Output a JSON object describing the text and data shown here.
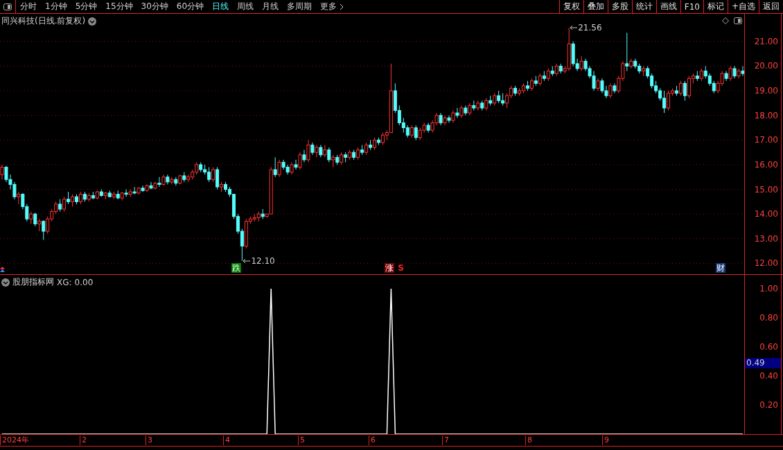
{
  "toolbar": {
    "period_tabs": [
      {
        "label": "分时",
        "selected": false
      },
      {
        "label": "1分钟",
        "selected": false
      },
      {
        "label": "5分钟",
        "selected": false
      },
      {
        "label": "15分钟",
        "selected": false
      },
      {
        "label": "30分钟",
        "selected": false
      },
      {
        "label": "60分钟",
        "selected": false
      },
      {
        "label": "日线",
        "selected": true
      },
      {
        "label": "周线",
        "selected": false
      },
      {
        "label": "月线",
        "selected": false
      },
      {
        "label": "多周期",
        "selected": false
      }
    ],
    "more": "更多",
    "buttons": [
      "复权",
      "叠加",
      "多股",
      "统计",
      "画线",
      "F10",
      "标记",
      "+自选",
      "返回"
    ]
  },
  "price_pane": {
    "title": "同兴科技(日线.前复权)",
    "events": [
      {
        "kind": "fall",
        "label": "跌"
      },
      {
        "kind": "rise",
        "label": "涨"
      },
      {
        "kind": "signal",
        "label": "S"
      },
      {
        "kind": "finance",
        "label": "财"
      }
    ],
    "chart_data": {
      "type": "candlestick",
      "grid": true,
      "ylim": [
        11.56,
        22.12
      ],
      "yticks": [
        {
          "value": 21,
          "label": "21.00"
        },
        {
          "value": 20,
          "label": "20.00"
        },
        {
          "value": 19,
          "label": "19.00"
        },
        {
          "value": 18,
          "label": "18.00"
        },
        {
          "value": 17,
          "label": "17.00"
        },
        {
          "value": 16,
          "label": "16.00"
        },
        {
          "value": 15,
          "label": "15.00"
        },
        {
          "value": 14,
          "label": "14.00"
        },
        {
          "value": 13,
          "label": "13.00"
        },
        {
          "value": 12,
          "label": "12.00"
        }
      ],
      "annotations": [
        "21.56",
        "12.10"
      ],
      "ohlc": [
        [
          15.6,
          16.0,
          15.4,
          15.9
        ],
        [
          15.9,
          15.95,
          15.3,
          15.4
        ],
        [
          15.4,
          15.6,
          15.0,
          15.2
        ],
        [
          15.2,
          15.3,
          14.6,
          14.7
        ],
        [
          14.7,
          14.9,
          14.4,
          14.8
        ],
        [
          14.8,
          14.85,
          14.2,
          14.3
        ],
        [
          14.3,
          14.4,
          13.7,
          13.8
        ],
        [
          13.8,
          14.1,
          13.6,
          14.0
        ],
        [
          14.0,
          14.05,
          13.5,
          13.6
        ],
        [
          13.6,
          13.8,
          13.3,
          13.7
        ],
        [
          13.7,
          13.75,
          12.95,
          13.3
        ],
        [
          13.3,
          13.9,
          13.2,
          13.8
        ],
        [
          13.8,
          14.2,
          13.7,
          14.1
        ],
        [
          14.1,
          14.5,
          14.0,
          14.4
        ],
        [
          14.4,
          14.6,
          14.1,
          14.2
        ],
        [
          14.2,
          14.7,
          14.1,
          14.6
        ],
        [
          14.6,
          14.9,
          14.4,
          14.5
        ],
        [
          14.5,
          14.8,
          14.3,
          14.7
        ],
        [
          14.7,
          14.8,
          14.4,
          14.5
        ],
        [
          14.5,
          14.9,
          14.4,
          14.8
        ],
        [
          14.8,
          14.9,
          14.5,
          14.6
        ],
        [
          14.6,
          14.85,
          14.5,
          14.75
        ],
        [
          14.75,
          14.9,
          14.6,
          14.65
        ],
        [
          14.65,
          14.95,
          14.6,
          14.9
        ],
        [
          14.9,
          15.0,
          14.7,
          14.75
        ],
        [
          14.75,
          14.9,
          14.6,
          14.85
        ],
        [
          14.85,
          14.95,
          14.7,
          14.7
        ],
        [
          14.7,
          14.9,
          14.6,
          14.8
        ],
        [
          14.8,
          14.95,
          14.6,
          14.65
        ],
        [
          14.65,
          14.9,
          14.55,
          14.85
        ],
        [
          14.85,
          15.0,
          14.7,
          14.8
        ],
        [
          14.8,
          15.0,
          14.7,
          14.9
        ],
        [
          14.9,
          15.1,
          14.8,
          14.85
        ],
        [
          14.85,
          15.1,
          14.8,
          15.05
        ],
        [
          15.05,
          15.15,
          14.9,
          14.95
        ],
        [
          14.95,
          15.2,
          14.9,
          15.15
        ],
        [
          15.15,
          15.3,
          15.0,
          15.05
        ],
        [
          15.05,
          15.3,
          15.0,
          15.25
        ],
        [
          15.25,
          15.5,
          15.1,
          15.2
        ],
        [
          15.2,
          15.6,
          15.15,
          15.5
        ],
        [
          15.5,
          15.6,
          15.2,
          15.3
        ],
        [
          15.3,
          15.5,
          15.2,
          15.4
        ],
        [
          15.4,
          15.5,
          15.15,
          15.25
        ],
        [
          15.25,
          15.6,
          15.2,
          15.55
        ],
        [
          15.55,
          15.7,
          15.3,
          15.4
        ],
        [
          15.4,
          15.6,
          15.3,
          15.5
        ],
        [
          15.5,
          15.8,
          15.4,
          15.7
        ],
        [
          15.7,
          16.1,
          15.6,
          16.0
        ],
        [
          16.0,
          16.1,
          15.7,
          15.8
        ],
        [
          15.8,
          16.0,
          15.6,
          15.7
        ],
        [
          15.7,
          15.9,
          15.3,
          15.4
        ],
        [
          15.4,
          15.9,
          15.3,
          15.8
        ],
        [
          15.8,
          15.9,
          15.0,
          15.1
        ],
        [
          15.1,
          15.3,
          14.9,
          15.2
        ],
        [
          15.2,
          15.3,
          14.9,
          15.0
        ],
        [
          15.0,
          15.1,
          14.7,
          14.8
        ],
        [
          14.8,
          14.8,
          13.8,
          13.9
        ],
        [
          13.9,
          14.0,
          13.2,
          13.3
        ],
        [
          13.3,
          13.4,
          12.1,
          12.7
        ],
        [
          12.7,
          13.8,
          12.6,
          13.7
        ],
        [
          13.7,
          13.9,
          13.6,
          13.8
        ],
        [
          13.8,
          14.0,
          13.7,
          13.85
        ],
        [
          13.85,
          14.1,
          13.7,
          14.0
        ],
        [
          14.0,
          14.2,
          13.8,
          13.9
        ],
        [
          13.9,
          14.0,
          13.85,
          14.0
        ],
        [
          14.0,
          15.9,
          14.0,
          15.8
        ],
        [
          15.8,
          16.3,
          15.5,
          15.6
        ],
        [
          15.6,
          16.2,
          15.5,
          16.1
        ],
        [
          16.1,
          16.2,
          15.8,
          15.9
        ],
        [
          15.9,
          16.0,
          15.6,
          15.7
        ],
        [
          15.7,
          16.1,
          15.6,
          16.0
        ],
        [
          16.0,
          16.2,
          15.8,
          15.9
        ],
        [
          15.9,
          16.5,
          15.8,
          16.4
        ],
        [
          16.4,
          16.6,
          16.1,
          16.2
        ],
        [
          16.2,
          17.0,
          16.1,
          16.8
        ],
        [
          16.8,
          16.9,
          16.4,
          16.5
        ],
        [
          16.5,
          16.8,
          16.3,
          16.7
        ],
        [
          16.7,
          16.8,
          16.3,
          16.4
        ],
        [
          16.4,
          16.8,
          16.3,
          16.6
        ],
        [
          16.6,
          16.7,
          16.1,
          16.2
        ],
        [
          16.2,
          16.4,
          15.9,
          16.3
        ],
        [
          16.3,
          16.4,
          16.0,
          16.1
        ],
        [
          16.1,
          16.5,
          16.0,
          16.4
        ],
        [
          16.4,
          16.5,
          16.1,
          16.3
        ],
        [
          16.3,
          16.6,
          16.2,
          16.5
        ],
        [
          16.5,
          16.6,
          16.2,
          16.3
        ],
        [
          16.3,
          16.7,
          16.2,
          16.6
        ],
        [
          16.6,
          16.8,
          16.4,
          16.5
        ],
        [
          16.5,
          16.9,
          16.4,
          16.8
        ],
        [
          16.8,
          17.0,
          16.6,
          16.7
        ],
        [
          16.7,
          17.1,
          16.6,
          17.0
        ],
        [
          17.0,
          17.1,
          16.8,
          16.9
        ],
        [
          16.9,
          17.3,
          16.8,
          17.2
        ],
        [
          17.2,
          17.4,
          17.0,
          17.3
        ],
        [
          17.3,
          20.1,
          17.3,
          19.0
        ],
        [
          19.0,
          19.3,
          18.1,
          18.2
        ],
        [
          18.2,
          18.4,
          17.6,
          17.7
        ],
        [
          17.7,
          17.9,
          17.3,
          17.5
        ],
        [
          17.5,
          17.6,
          17.1,
          17.2
        ],
        [
          17.2,
          17.6,
          17.1,
          17.5
        ],
        [
          17.5,
          17.6,
          17.0,
          17.1
        ],
        [
          17.1,
          17.5,
          17.0,
          17.4
        ],
        [
          17.4,
          17.7,
          17.3,
          17.6
        ],
        [
          17.6,
          17.7,
          17.3,
          17.4
        ],
        [
          17.4,
          17.8,
          17.3,
          17.7
        ],
        [
          17.7,
          18.1,
          17.6,
          18.0
        ],
        [
          18.0,
          18.1,
          17.6,
          17.7
        ],
        [
          17.7,
          18.0,
          17.6,
          17.9
        ],
        [
          17.9,
          18.0,
          17.7,
          17.8
        ],
        [
          17.8,
          18.2,
          17.7,
          18.1
        ],
        [
          18.1,
          18.3,
          17.9,
          18.0
        ],
        [
          18.0,
          18.4,
          17.9,
          18.3
        ],
        [
          18.3,
          18.4,
          18.0,
          18.1
        ],
        [
          18.1,
          18.5,
          18.0,
          18.4
        ],
        [
          18.4,
          18.6,
          18.2,
          18.3
        ],
        [
          18.3,
          18.6,
          18.2,
          18.5
        ],
        [
          18.5,
          18.6,
          18.2,
          18.3
        ],
        [
          18.3,
          18.7,
          18.2,
          18.6
        ],
        [
          18.6,
          18.8,
          18.4,
          18.5
        ],
        [
          18.5,
          18.9,
          18.4,
          18.8
        ],
        [
          18.8,
          19.0,
          18.5,
          18.6
        ],
        [
          18.6,
          18.9,
          18.4,
          18.5
        ],
        [
          18.5,
          18.9,
          18.3,
          18.8
        ],
        [
          18.8,
          19.2,
          18.7,
          19.1
        ],
        [
          19.1,
          19.2,
          18.8,
          18.9
        ],
        [
          18.9,
          19.1,
          18.8,
          19.0
        ],
        [
          19.0,
          19.3,
          18.9,
          19.2
        ],
        [
          19.2,
          19.4,
          19.0,
          19.1
        ],
        [
          19.1,
          19.5,
          19.0,
          19.4
        ],
        [
          19.4,
          19.6,
          19.2,
          19.3
        ],
        [
          19.3,
          19.7,
          19.2,
          19.6
        ],
        [
          19.6,
          19.8,
          19.4,
          19.5
        ],
        [
          19.5,
          19.9,
          19.4,
          19.8
        ],
        [
          19.8,
          20.0,
          19.6,
          19.7
        ],
        [
          19.7,
          20.1,
          19.6,
          20.0
        ],
        [
          20.0,
          20.1,
          19.7,
          19.8
        ],
        [
          19.8,
          20.0,
          19.7,
          19.9
        ],
        [
          19.9,
          21.56,
          19.8,
          20.9
        ],
        [
          20.9,
          21.0,
          20.0,
          20.1
        ],
        [
          20.1,
          20.3,
          19.8,
          19.9
        ],
        [
          19.9,
          20.4,
          19.8,
          20.2
        ],
        [
          20.2,
          20.3,
          19.8,
          19.9
        ],
        [
          19.9,
          20.0,
          19.5,
          19.6
        ],
        [
          19.6,
          19.8,
          19.0,
          19.1
        ],
        [
          19.1,
          19.5,
          19.0,
          19.4
        ],
        [
          19.4,
          19.5,
          18.9,
          19.0
        ],
        [
          19.0,
          19.2,
          18.7,
          18.8
        ],
        [
          18.8,
          19.3,
          18.7,
          19.2
        ],
        [
          19.2,
          19.3,
          18.9,
          19.0
        ],
        [
          19.0,
          19.6,
          18.9,
          19.5
        ],
        [
          19.5,
          20.2,
          19.4,
          20.1
        ],
        [
          20.1,
          21.35,
          19.8,
          20.0
        ],
        [
          20.0,
          20.3,
          19.9,
          20.2
        ],
        [
          20.2,
          20.3,
          19.9,
          20.0
        ],
        [
          20.0,
          20.1,
          19.7,
          19.8
        ],
        [
          19.8,
          20.0,
          19.6,
          19.9
        ],
        [
          19.9,
          20.0,
          19.5,
          19.6
        ],
        [
          19.6,
          19.7,
          19.1,
          19.2
        ],
        [
          19.2,
          19.4,
          18.9,
          19.0
        ],
        [
          19.0,
          19.1,
          18.6,
          18.7
        ],
        [
          18.7,
          19.0,
          18.1,
          18.3
        ],
        [
          18.3,
          19.0,
          18.2,
          18.9
        ],
        [
          18.9,
          19.1,
          18.8,
          19.0
        ],
        [
          19.0,
          19.2,
          18.8,
          18.9
        ],
        [
          18.9,
          19.4,
          18.8,
          19.3
        ],
        [
          19.3,
          19.4,
          18.6,
          18.8
        ],
        [
          18.8,
          19.6,
          18.7,
          19.5
        ],
        [
          19.5,
          19.7,
          19.3,
          19.6
        ],
        [
          19.6,
          19.8,
          19.4,
          19.5
        ],
        [
          19.5,
          19.9,
          19.4,
          19.8
        ],
        [
          19.8,
          20.0,
          19.5,
          19.6
        ],
        [
          19.6,
          19.7,
          19.2,
          19.3
        ],
        [
          19.3,
          19.4,
          18.9,
          19.0
        ],
        [
          19.0,
          19.4,
          18.9,
          19.3
        ],
        [
          19.3,
          19.8,
          19.2,
          19.7
        ],
        [
          19.7,
          19.8,
          19.4,
          19.5
        ],
        [
          19.5,
          20.0,
          19.4,
          19.9
        ],
        [
          19.9,
          20.0,
          19.5,
          19.6
        ],
        [
          19.6,
          19.9,
          19.5,
          19.8
        ],
        [
          19.8,
          20.0,
          19.6,
          19.7
        ]
      ]
    }
  },
  "indicator_pane": {
    "title": "股朋指标网",
    "reading": "0.00",
    "cursor_value": "0.49",
    "chart_data": {
      "type": "line",
      "ylim": [
        0,
        1.095
      ],
      "yticks": [
        {
          "value": 1,
          "label": "1.00"
        },
        {
          "value": 0.8,
          "label": "0.80"
        },
        {
          "value": 0.6,
          "label": "0.60"
        },
        {
          "value": 0.4,
          "label": "0.40"
        },
        {
          "value": 0.2,
          "label": "0.20"
        }
      ],
      "series": [
        {
          "name": "XG:",
          "color": "#ffffff",
          "values": [
            0,
            0,
            0,
            0,
            0,
            0,
            0,
            0,
            0,
            0,
            0,
            0,
            0,
            0,
            0,
            0,
            0,
            0,
            0,
            0,
            0,
            0,
            0,
            0,
            0,
            0,
            0,
            0,
            0,
            0,
            0,
            0,
            0,
            0,
            0,
            0,
            0,
            0,
            0,
            0,
            0,
            0,
            0,
            0,
            0,
            0,
            0,
            0,
            0,
            0,
            0,
            0,
            0,
            0,
            0,
            0,
            0,
            0,
            0,
            0,
            0,
            0,
            0,
            0,
            0,
            1,
            0,
            0,
            0,
            0,
            0,
            0,
            0,
            0,
            0,
            0,
            0,
            0,
            0,
            0,
            0,
            0,
            0,
            0,
            0,
            0,
            0,
            0,
            0,
            0,
            0,
            0,
            0,
            0,
            1,
            0,
            0,
            0,
            0,
            0,
            0,
            0,
            0,
            0,
            0,
            0,
            0,
            0,
            0,
            0,
            0,
            0,
            0,
            0,
            0,
            0,
            0,
            0,
            0,
            0,
            0,
            0,
            0,
            0,
            0,
            0,
            0,
            0,
            0,
            0,
            0,
            0,
            0,
            0,
            0,
            0,
            0,
            0,
            0,
            0,
            0,
            0,
            0,
            0,
            0,
            0,
            0,
            0,
            0,
            0,
            0,
            0,
            0,
            0,
            0,
            0,
            0,
            0,
            0,
            0,
            0,
            0,
            0,
            0,
            0,
            0,
            0,
            0,
            0,
            0,
            0,
            0,
            0,
            0,
            0,
            0,
            0,
            0,
            0,
            0
          ]
        }
      ]
    }
  },
  "date_axis": [
    "2024年",
    "2",
    "3",
    "4",
    "5",
    "6",
    "7",
    "8",
    "9"
  ]
}
